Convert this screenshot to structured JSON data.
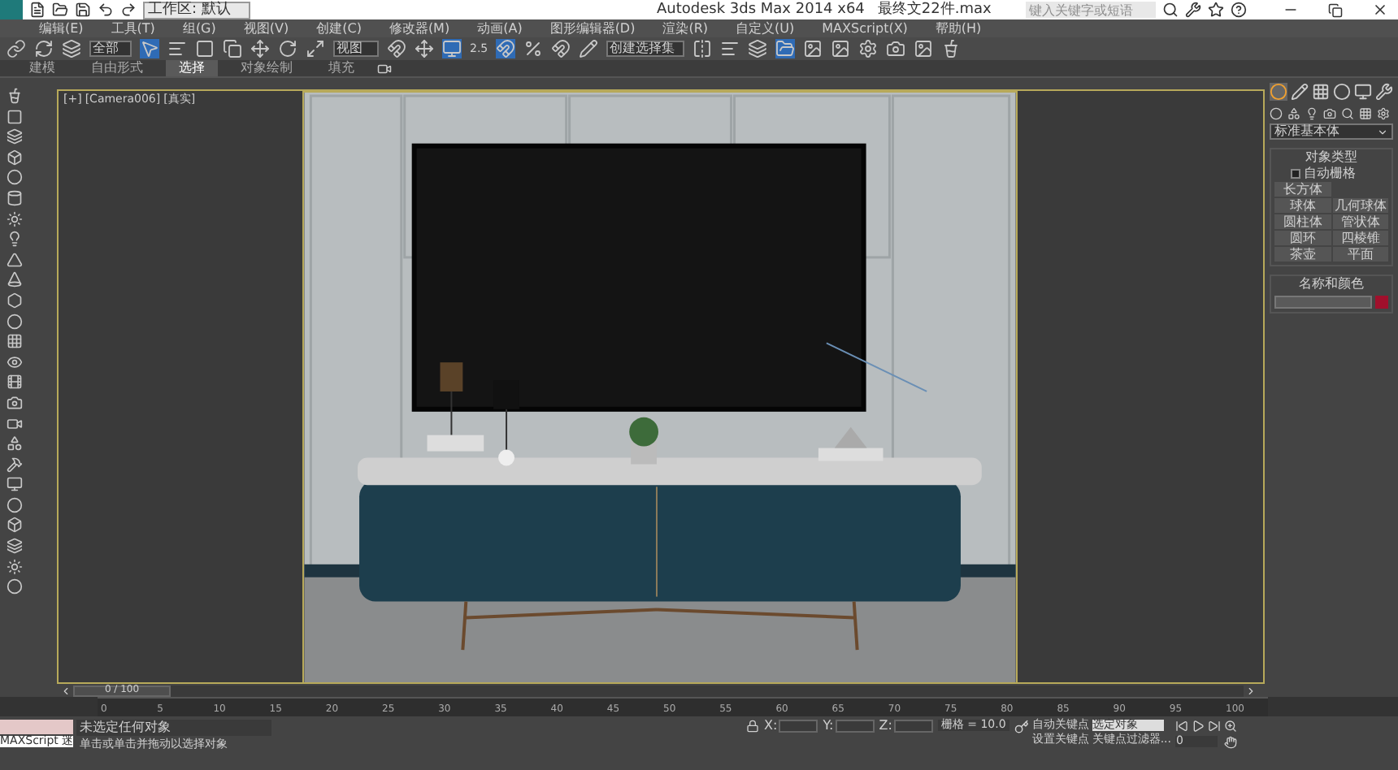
{
  "title_bar": {
    "workspace": "工作区: 默认",
    "title": "Autodesk 3ds Max  2014 x64",
    "filename": "最终文22件.max",
    "search": {
      "placeholder": "键入关键字或短语"
    }
  },
  "menu": [
    "编辑(E)",
    "工具(T)",
    "组(G)",
    "视图(V)",
    "创建(C)",
    "修改器(M)",
    "动画(A)",
    "图形编辑器(D)",
    "渲染(R)",
    "自定义(U)",
    "MAXScript(X)",
    "帮助(H)"
  ],
  "toolbar": {
    "selection_filter": "全部",
    "reference_coord": "视图",
    "snap_label": "2.5",
    "named_selection": "创建选择集"
  },
  "ribbon_tabs": [
    {
      "label": "建模",
      "selected": false
    },
    {
      "label": "自由形式",
      "selected": false
    },
    {
      "label": "选择",
      "selected": true
    },
    {
      "label": "对象绘制",
      "selected": false
    },
    {
      "label": "填充",
      "selected": false
    }
  ],
  "viewport": {
    "labels": [
      "[+]",
      "[Camera006]",
      "[真实]"
    ]
  },
  "command_panel": {
    "tabs": [
      {
        "selected": true
      },
      {
        "selected": false
      },
      {
        "selected": false
      },
      {
        "selected": false
      },
      {
        "selected": false
      },
      {
        "selected": false
      }
    ],
    "dropdown": "标准基本体",
    "object_type": {
      "title": "对象类型",
      "checkbox": {
        "label": "自动栅格",
        "checked": false
      },
      "buttons": [
        "长方体",
        "球体",
        "几何球体",
        "圆柱体",
        "管状体",
        "圆环",
        "四棱锥",
        "茶壶",
        "平面"
      ]
    },
    "name_color": {
      "title": "名称和颜色",
      "color": "#a0102c"
    }
  },
  "timeline": {
    "frame": "0 / 100",
    "level": 0,
    "ticks": [
      "0",
      "5",
      "10",
      "15",
      "20",
      "25",
      "30",
      "35",
      "40",
      "45",
      "50",
      "55",
      "60",
      "65",
      "70",
      "75",
      "80",
      "85",
      "90",
      "95",
      "100"
    ]
  },
  "status": {
    "maxscript": "MAXScript 迷",
    "selection": "未选定任何对象",
    "prompt": "单击或单击并拖动以选择对象",
    "x_label": "X:",
    "y_label": "Y:",
    "z_label": "Z:",
    "grid": "栅格 = 10.0",
    "auto_key": "自动关键点",
    "key_mode": "选定对象",
    "set_key": "设置关键点",
    "key_filter": "关键点过滤器...",
    "current_frame": "0"
  }
}
